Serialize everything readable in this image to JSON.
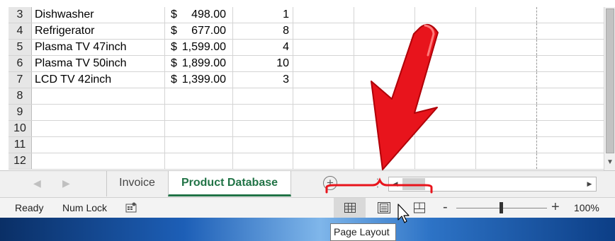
{
  "sheet": {
    "rows": [
      {
        "row": "3",
        "name": "Dishwasher",
        "currency": "$",
        "price": "498.00",
        "qty": "1"
      },
      {
        "row": "4",
        "name": "Refrigerator",
        "currency": "$",
        "price": "677.00",
        "qty": "8"
      },
      {
        "row": "5",
        "name": "Plasma TV 47inch",
        "currency": "$",
        "price": "1,599.00",
        "qty": "4"
      },
      {
        "row": "6",
        "name": "Plasma TV 50inch",
        "currency": "$",
        "price": "1,899.00",
        "qty": "10"
      },
      {
        "row": "7",
        "name": "LCD TV 42inch",
        "currency": "$",
        "price": "1,399.00",
        "qty": "3"
      },
      {
        "row": "8",
        "name": "",
        "currency": "",
        "price": "",
        "qty": ""
      },
      {
        "row": "9",
        "name": "",
        "currency": "",
        "price": "",
        "qty": ""
      },
      {
        "row": "10",
        "name": "",
        "currency": "",
        "price": "",
        "qty": ""
      },
      {
        "row": "11",
        "name": "",
        "currency": "",
        "price": "",
        "qty": ""
      },
      {
        "row": "12",
        "name": "",
        "currency": "",
        "price": "",
        "qty": ""
      }
    ]
  },
  "tabs": {
    "items": [
      {
        "label": "Invoice",
        "active": false
      },
      {
        "label": "Product Database",
        "active": true
      }
    ],
    "add_symbol": "+",
    "active_color": "#217346"
  },
  "status": {
    "ready": "Ready",
    "num_lock": "Num Lock",
    "zoom_minus": "-",
    "zoom_plus": "+",
    "zoom_percent": "100%",
    "zoom_level": 100
  },
  "views": {
    "normal_icon": "grid-icon",
    "layout_icon": "page-layout-icon",
    "break_icon": "page-break-icon"
  },
  "tooltip": {
    "text": "Page Layout"
  },
  "annotation": {
    "arrow_color": "#e8141c",
    "bracket_color": "#e8141c"
  }
}
